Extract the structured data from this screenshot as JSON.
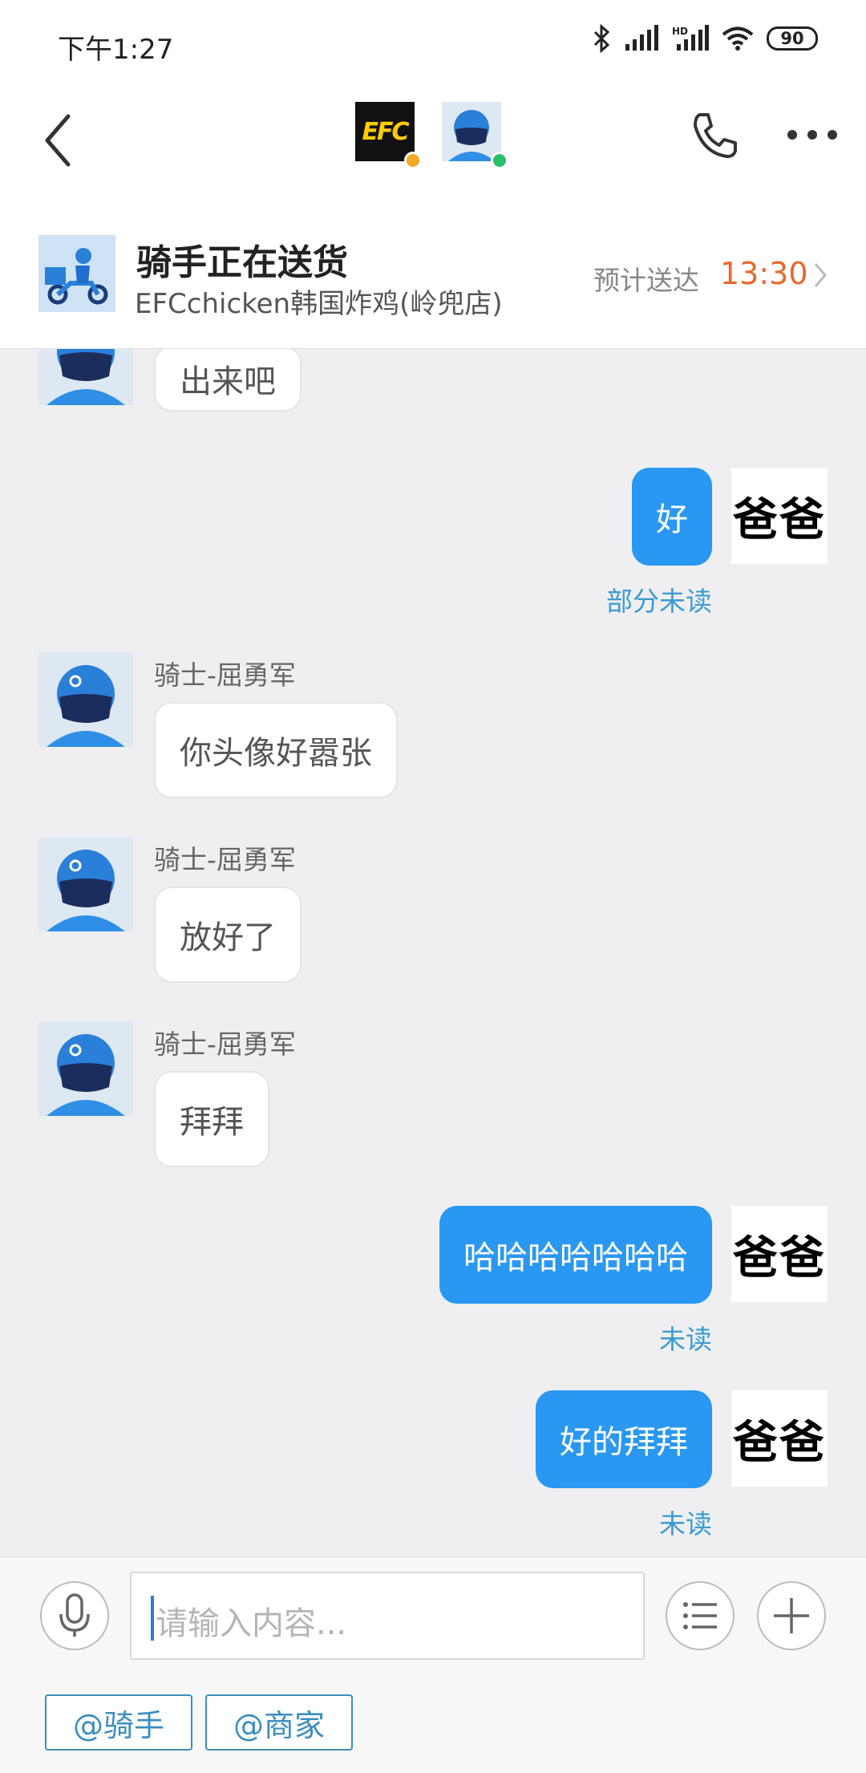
{
  "status_bar": {
    "time": "下午1:27",
    "battery": "90"
  },
  "header": {
    "merchant_logo_text": "EFC",
    "icons": [
      "back-arrow-icon",
      "phone-icon",
      "more-dots-icon"
    ]
  },
  "order": {
    "title": "骑手正在送货",
    "shop": "EFCchicken韩国炸鸡(岭兜店)",
    "eta_label": "预计送达",
    "eta_time": "13:30"
  },
  "messages": [
    {
      "from": "rider",
      "text": "出来吧"
    },
    {
      "from": "me",
      "text": "好",
      "avatar_text": "爸爸",
      "status": "部分未读"
    },
    {
      "from": "rider",
      "sender": "骑士-屈勇军",
      "text": "你头像好嚣张"
    },
    {
      "from": "rider",
      "sender": "骑士-屈勇军",
      "text": "放好了"
    },
    {
      "from": "rider",
      "sender": "骑士-屈勇军",
      "text": "拜拜"
    },
    {
      "from": "me",
      "text": "哈哈哈哈哈哈哈",
      "avatar_text": "爸爸",
      "status": "未读"
    },
    {
      "from": "me",
      "text": "好的拜拜",
      "avatar_text": "爸爸",
      "status": "未读"
    }
  ],
  "input": {
    "placeholder": "请输入内容..."
  },
  "mentions": [
    "@骑手",
    "@商家"
  ],
  "colors": {
    "accent": "#2a98f3",
    "eta": "#e8692e",
    "read_status": "#3a9bd4"
  }
}
